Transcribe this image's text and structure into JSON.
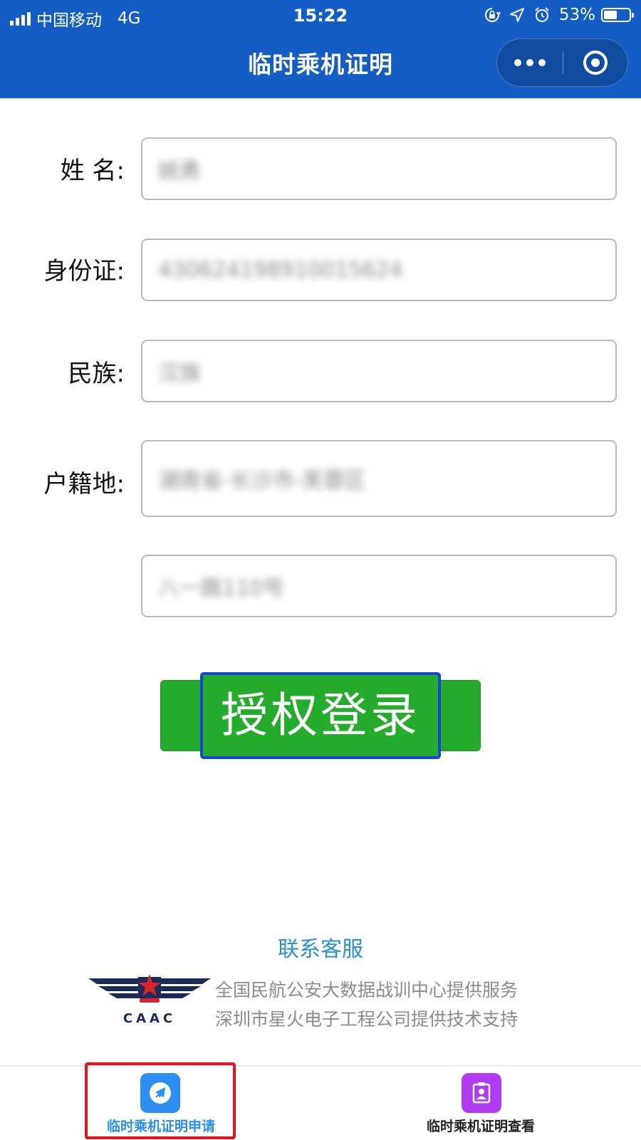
{
  "status_bar": {
    "carrier": "中国移动",
    "network": "4G",
    "time": "15:22",
    "battery_percent": "53%",
    "battery_level": 0.53
  },
  "nav": {
    "title": "临时乘机证明"
  },
  "form": {
    "name_label": "姓 名:",
    "name_value": "姚勇",
    "id_label": "身份证:",
    "id_value": "430624198910015624",
    "ethnicity_label": "民族:",
    "ethnicity_value": "汉族",
    "household_label": "户籍地:",
    "household_region_value": "湖南省-长沙市-芙蓉区",
    "household_address_value": "八一路110号"
  },
  "actions": {
    "authorize_login_label": "授权登录"
  },
  "footer": {
    "contact_label": "联系客服",
    "logo_text": "CAAC",
    "service_line": "全国民航公安大数据战训中心提供服务",
    "support_line": "深圳市星火电子工程公司提供技术支持"
  },
  "tabbar": {
    "tabs": [
      {
        "label": "临时乘机证明申请",
        "icon": "airplane-icon",
        "color": "#2b8ef0",
        "active": true
      },
      {
        "label": "临时乘机证明查看",
        "icon": "badge-icon",
        "color": "#b03bf0",
        "active": false
      }
    ]
  },
  "colors": {
    "header_bg": "#145dc4",
    "button_bg": "#25ac2c",
    "link": "#2a8ed8",
    "active_tab_text": "#2b8ef0",
    "highlight_red": "#e3141d",
    "highlight_blue": "#1546d8"
  }
}
